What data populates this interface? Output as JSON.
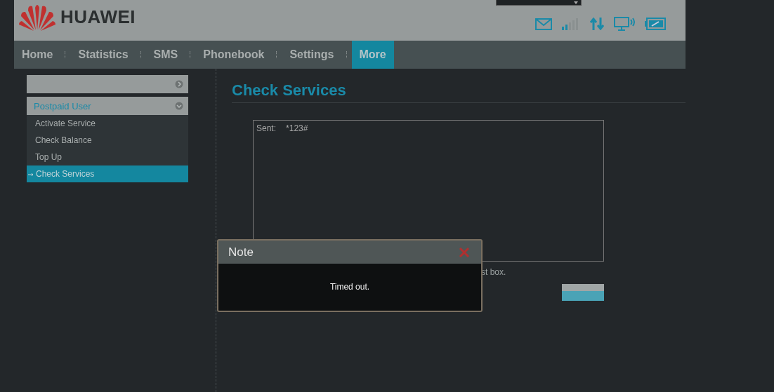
{
  "header": {
    "logo_text": "HUAWEI"
  },
  "nav": [
    {
      "label": "Home",
      "selected": false
    },
    {
      "label": "Statistics",
      "selected": false
    },
    {
      "label": "SMS",
      "selected": false
    },
    {
      "label": "Phonebook",
      "selected": false
    },
    {
      "label": "Settings",
      "selected": false
    },
    {
      "label": "More",
      "selected": true
    }
  ],
  "sidebar": {
    "groups": [
      {
        "expanded": false
      },
      {
        "label": "Postpaid User",
        "expanded": true,
        "items": [
          {
            "label": "Activate Service",
            "selected": false
          },
          {
            "label": "Check Balance",
            "selected": false
          },
          {
            "label": "Top Up",
            "selected": false
          },
          {
            "label": "Check Services",
            "selected": true
          }
        ]
      }
    ]
  },
  "content": {
    "title": "Check Services",
    "sent_label": "Sent:",
    "sent_value": "*123#",
    "hint": "st box."
  },
  "dialog": {
    "title": "Note",
    "message": "Timed out."
  }
}
